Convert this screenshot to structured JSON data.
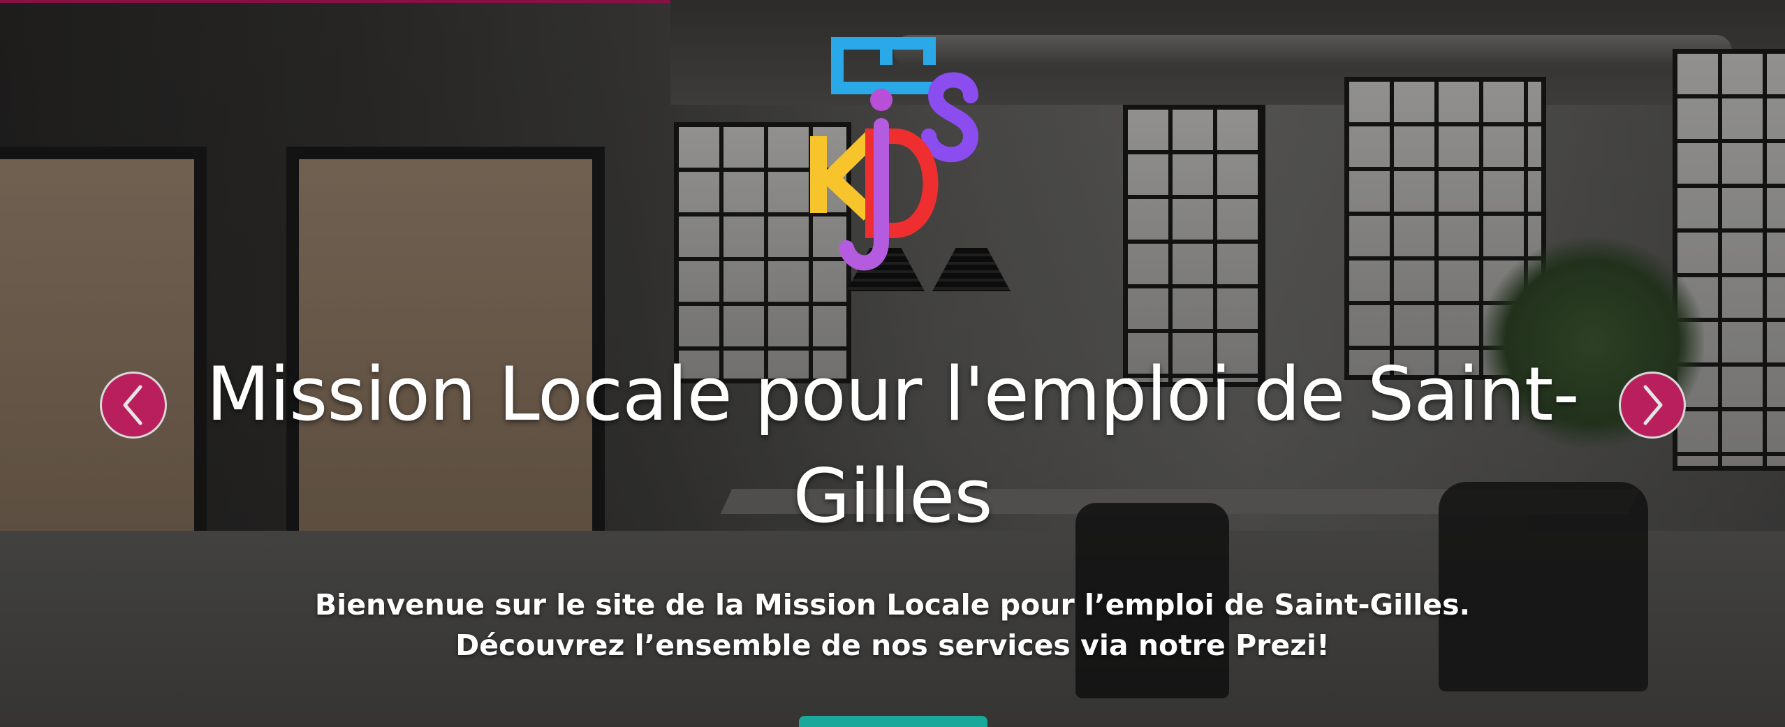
{
  "hero": {
    "title": "Mission Locale pour l'emploi de Saint-Gilles",
    "subtitle_line1": "Bienvenue sur le site de la Mission Locale pour l’emploi de Saint-Gilles.",
    "subtitle_line2": "Découvrez l’ensemble de nos services via notre Prezi!"
  },
  "logo": {
    "letters": [
      "E",
      "S",
      "K",
      "J",
      "D"
    ],
    "colors": {
      "E": "#29a9e8",
      "dot": "#b94fd6",
      "S": "#8b4cf0",
      "K": "#f7c52b",
      "J": "#b45be0",
      "D": "#ef2f2f"
    }
  },
  "carousel": {
    "prev_icon": "chevron-left-icon",
    "next_icon": "chevron-right-icon",
    "arrow_color": "#b81f5c"
  },
  "colors": {
    "top_accent": "#c0175d",
    "cta": "#1aa89a"
  }
}
